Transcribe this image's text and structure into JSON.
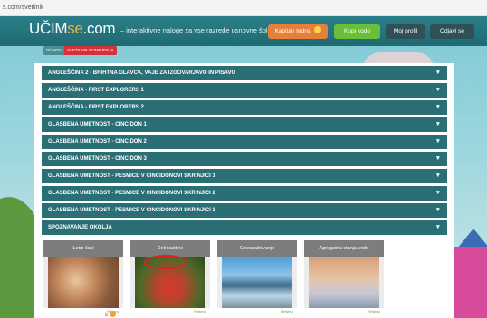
{
  "browser": {
    "url": "s.com/svetilnik"
  },
  "header": {
    "logo_main": "UČIM",
    "logo_accent": "se",
    "logo_tld": ".com",
    "tagline": "– interaktivne naloge za vse razrede osnovne šole",
    "kapitan_label": "Kapitan tedna",
    "kupi_label": "Kupi kodo",
    "profil_label": "Moj profil",
    "odjavi_label": "Odjavi se"
  },
  "breadcrumb": {
    "home": "DOMOV",
    "current": "SVETILNIK POMNJENJA"
  },
  "subjects": [
    {
      "label": "ANGLEŠČINA 2 - BRIHTNA GLAVCA, VAJE ZA IZGOVARJAVO IN PISAVO"
    },
    {
      "label": "ANGLEŠČINA - FIRST EXPLORERS 1"
    },
    {
      "label": "ANGLEŠČINA - FIRST EXPLORERS 2"
    },
    {
      "label": "GLASBENA UMETNOST - CINCIDON 1"
    },
    {
      "label": "GLASBENA UMETNOST - CINCIDON 2"
    },
    {
      "label": "GLASBENA UMETNOST - CINCIDON 3"
    },
    {
      "label": "GLASBENA UMETNOST - PESMICE V CINCIDONOVI SKRINJICI 1"
    },
    {
      "label": "GLASBENA UMETNOST - PESMICE V CINCIDONOVI SKRINJICI 2"
    },
    {
      "label": "GLASBENA UMETNOST - PESMICE V CINCIDONOVI SKRINJICI 3"
    },
    {
      "label": "SPOZNAVANJE OKOLJA"
    }
  ],
  "arrow_glyph": "▼",
  "tiles": [
    {
      "title": "Letni časi",
      "status": "Rešeno"
    },
    {
      "title": "Deli rastline",
      "status": "Rešeno"
    },
    {
      "title": "Onesnaževanje",
      "status": "Rešeno"
    },
    {
      "title": "Agregatna stanja vode",
      "status": "Rešeno"
    }
  ],
  "pager": {
    "count": "5"
  },
  "colors": {
    "header_bg": "#1f6a73",
    "accordion_bg": "#2b6f76",
    "kapitan_btn": "#e5803a",
    "kupi_btn": "#6abf3a",
    "highlight": "#e0201e"
  }
}
